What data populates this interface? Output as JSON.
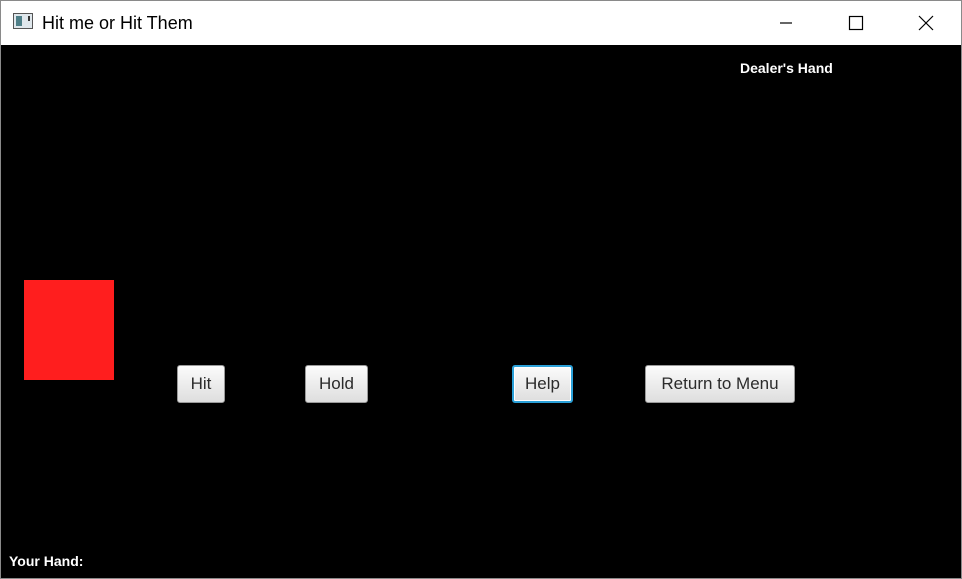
{
  "window": {
    "title": "Hit me or Hit Them",
    "controls": {
      "minimize": "minimize-icon",
      "maximize": "maximize-icon",
      "close": "close-icon"
    }
  },
  "game": {
    "dealer_label": "Dealer's Hand",
    "player_label": "Your Hand:",
    "card_color": "#ff1e1e",
    "background": "#000000"
  },
  "buttons": {
    "hit": "Hit",
    "hold": "Hold",
    "help": "Help",
    "menu": "Return to Menu"
  }
}
